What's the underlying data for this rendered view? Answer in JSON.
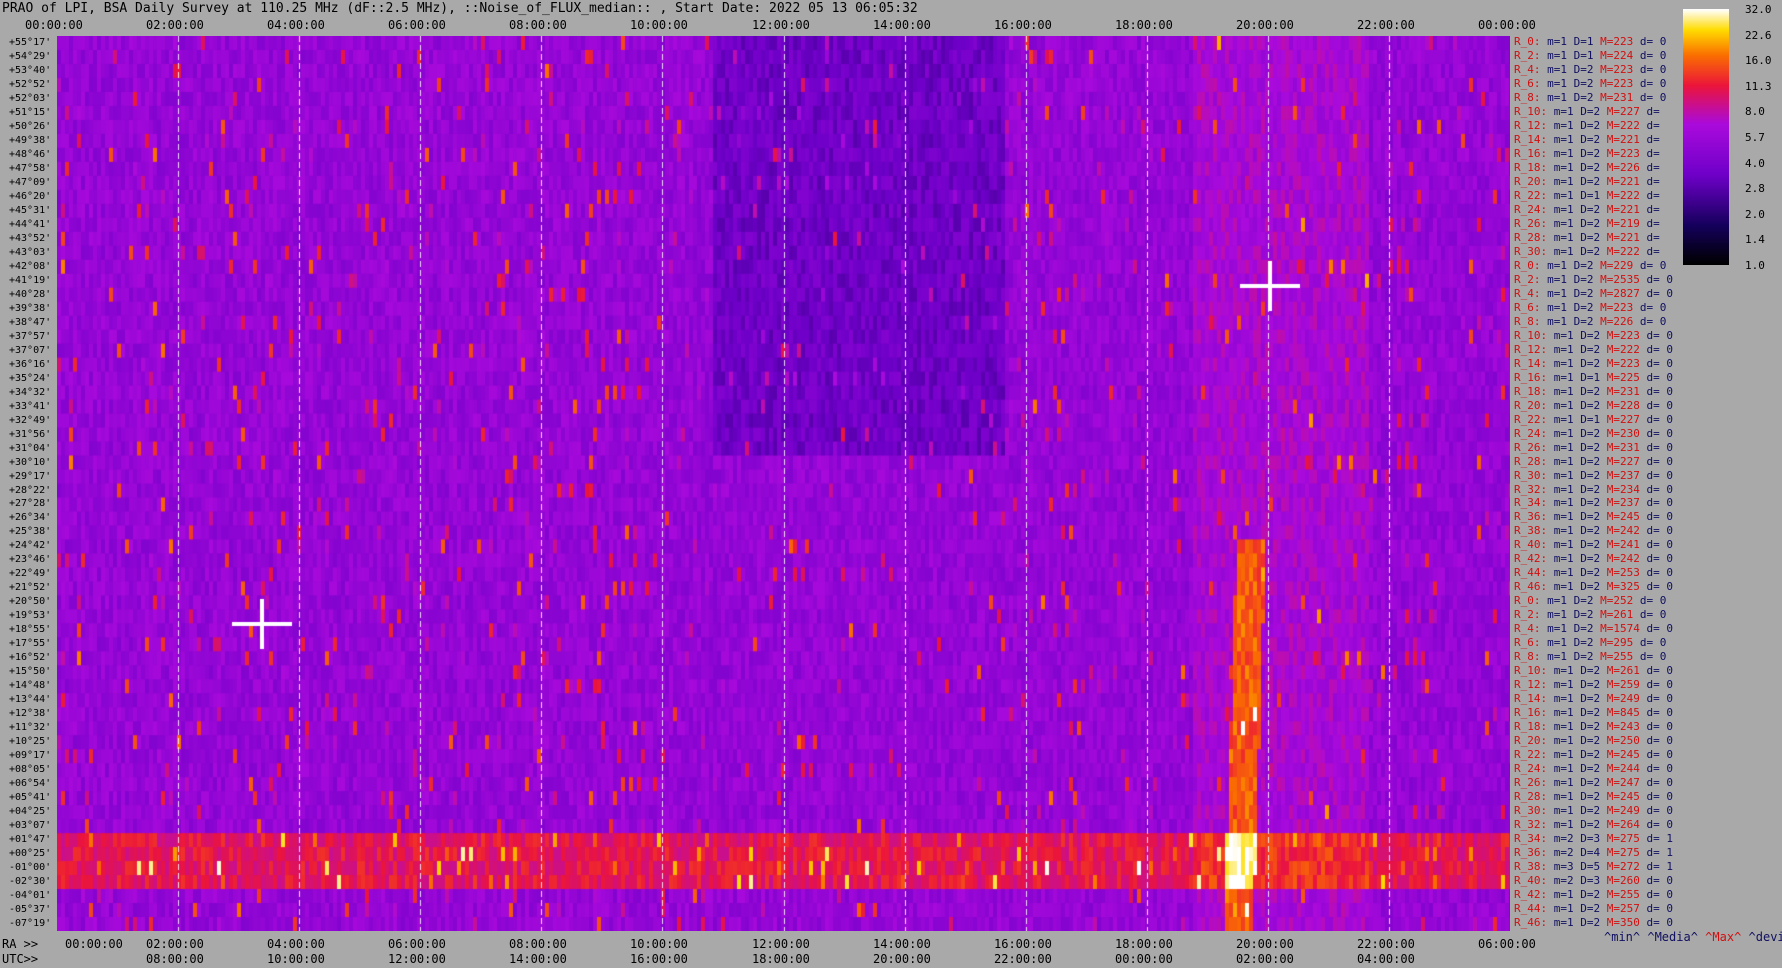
{
  "title": "PRAO of LPI, BSA Daily Survey at 110.25 MHz (dF::2.5 MHz), ::Noise_of_FLUX_median:: , Start Date: 2022 05 13 06:05:32",
  "chart_data": {
    "type": "heatmap",
    "top_ticks": [
      "00:00:00",
      "02:00:00",
      "04:00:00",
      "06:00:00",
      "08:00:00",
      "10:00:00",
      "12:00:00",
      "14:00:00",
      "16:00:00",
      "18:00:00",
      "20:00:00",
      "22:00:00",
      "00:00:00"
    ],
    "ra_prefix": "RA >>",
    "ra_ticks": [
      "00:00:00",
      "02:00:00",
      "04:00:00",
      "06:00:00",
      "08:00:00",
      "10:00:00",
      "12:00:00",
      "14:00:00",
      "16:00:00",
      "18:00:00",
      "20:00:00",
      "22:00:00",
      "06:00:00"
    ],
    "utc_prefix": "UTC>>",
    "utc_ticks": [
      "08:00:00",
      "10:00:00",
      "12:00:00",
      "14:00:00",
      "16:00:00",
      "18:00:00",
      "20:00:00",
      "22:00:00",
      "00:00:00",
      "02:00:00",
      "04:00:00"
    ],
    "declinations": [
      "+55°17'",
      "+54°29'",
      "+53°40'",
      "+52°52'",
      "+52°03'",
      "+51°15'",
      "+50°26'",
      "+49°38'",
      "+48°46'",
      "+47°58'",
      "+47°09'",
      "+46°20'",
      "+45°31'",
      "+44°41'",
      "+43°52'",
      "+43°03'",
      "+42°08'",
      "+41°19'",
      "+40°28'",
      "+39°38'",
      "+38°47'",
      "+37°57'",
      "+37°07'",
      "+36°16'",
      "+35°24'",
      "+34°32'",
      "+33°41'",
      "+32°49'",
      "+31°56'",
      "+31°04'",
      "+30°10'",
      "+29°17'",
      "+28°22'",
      "+27°28'",
      "+26°34'",
      "+25°38'",
      "+24°42'",
      "+23°46'",
      "+22°49'",
      "+21°52'",
      "+20°50'",
      "+19°53'",
      "+18°55'",
      "+17°55'",
      "+16°52'",
      "+15°50'",
      "+14°48'",
      "+13°44'",
      "+12°38'",
      "+11°32'",
      "+10°25'",
      "+09°17'",
      "+08°05'",
      "+06°54'",
      "+05°41'",
      "+04°25'",
      "+03°07'",
      "+01°47'",
      "+00°25'",
      "-01°00'",
      "-02°30'",
      "-04°01'",
      "-05°37'",
      "-07°19'"
    ],
    "colorbar": {
      "ticks": [
        "32.0",
        "22.6",
        "16.0",
        "11.3",
        "8.0",
        "5.7",
        "4.0",
        "2.8",
        "2.0",
        "1.4",
        "1.0"
      ],
      "min": 1.0,
      "max": 32.0
    },
    "stats": [
      {
        "r": "R_0:",
        "m": "m=1",
        "D": "D=1",
        "M": "M=223",
        "d": "d= 0"
      },
      {
        "r": "R_2:",
        "m": "m=1",
        "D": "D=1",
        "M": "M=224",
        "d": "d= 0"
      },
      {
        "r": "R_4:",
        "m": "m=1",
        "D": "D=2",
        "M": "M=223",
        "d": "d= 0"
      },
      {
        "r": "R_6:",
        "m": "m=1",
        "D": "D=2",
        "M": "M=223",
        "d": "d= 0"
      },
      {
        "r": "R_8:",
        "m": "m=1",
        "D": "D=2",
        "M": "M=231",
        "d": "d= 0"
      },
      {
        "r": "R_10:",
        "m": "m=1",
        "D": "D=2",
        "M": "M=227",
        "d": "d="
      },
      {
        "r": "R_12:",
        "m": "m=1",
        "D": "D=2",
        "M": "M=222",
        "d": "d="
      },
      {
        "r": "R_14:",
        "m": "m=1",
        "D": "D=2",
        "M": "M=221",
        "d": "d="
      },
      {
        "r": "R_16:",
        "m": "m=1",
        "D": "D=2",
        "M": "M=223",
        "d": "d="
      },
      {
        "r": "R_18:",
        "m": "m=1",
        "D": "D=2",
        "M": "M=226",
        "d": "d="
      },
      {
        "r": "R_20:",
        "m": "m=1",
        "D": "D=2",
        "M": "M=221",
        "d": "d="
      },
      {
        "r": "R_22:",
        "m": "m=1",
        "D": "D=1",
        "M": "M=222",
        "d": "d="
      },
      {
        "r": "R_24:",
        "m": "m=1",
        "D": "D=2",
        "M": "M=221",
        "d": "d="
      },
      {
        "r": "R_26:",
        "m": "m=1",
        "D": "D=2",
        "M": "M=219",
        "d": "d="
      },
      {
        "r": "R_28:",
        "m": "m=1",
        "D": "D=2",
        "M": "M=221",
        "d": "d="
      },
      {
        "r": "R_30:",
        "m": "m=1",
        "D": "D=2",
        "M": "M=222",
        "d": "d="
      },
      {
        "r": "R_0:",
        "m": "m=1",
        "D": "D=2",
        "M": "M=229",
        "d": "d= 0"
      },
      {
        "r": "R_2:",
        "m": "m=1",
        "D": "D=2",
        "M": "M=2535",
        "d": "d= 0"
      },
      {
        "r": "R_4:",
        "m": "m=1",
        "D": "D=2",
        "M": "M=2827",
        "d": "d= 0"
      },
      {
        "r": "R_6:",
        "m": "m=1",
        "D": "D=2",
        "M": "M=223",
        "d": "d= 0"
      },
      {
        "r": "R_8:",
        "m": "m=1",
        "D": "D=2",
        "M": "M=226",
        "d": "d= 0"
      },
      {
        "r": "R_10:",
        "m": "m=1",
        "D": "D=2",
        "M": "M=223",
        "d": "d= 0"
      },
      {
        "r": "R_12:",
        "m": "m=1",
        "D": "D=2",
        "M": "M=222",
        "d": "d= 0"
      },
      {
        "r": "R_14:",
        "m": "m=1",
        "D": "D=2",
        "M": "M=223",
        "d": "d= 0"
      },
      {
        "r": "R_16:",
        "m": "m=1",
        "D": "D=1",
        "M": "M=225",
        "d": "d= 0"
      },
      {
        "r": "R_18:",
        "m": "m=1",
        "D": "D=2",
        "M": "M=231",
        "d": "d= 0"
      },
      {
        "r": "R_20:",
        "m": "m=1",
        "D": "D=2",
        "M": "M=228",
        "d": "d= 0"
      },
      {
        "r": "R_22:",
        "m": "m=1",
        "D": "D=1",
        "M": "M=227",
        "d": "d= 0"
      },
      {
        "r": "R_24:",
        "m": "m=1",
        "D": "D=2",
        "M": "M=230",
        "d": "d= 0"
      },
      {
        "r": "R_26:",
        "m": "m=1",
        "D": "D=2",
        "M": "M=231",
        "d": "d= 0"
      },
      {
        "r": "R_28:",
        "m": "m=1",
        "D": "D=2",
        "M": "M=227",
        "d": "d= 0"
      },
      {
        "r": "R_30:",
        "m": "m=1",
        "D": "D=2",
        "M": "M=237",
        "d": "d= 0"
      },
      {
        "r": "R_32:",
        "m": "m=1",
        "D": "D=2",
        "M": "M=234",
        "d": "d= 0"
      },
      {
        "r": "R_34:",
        "m": "m=1",
        "D": "D=2",
        "M": "M=237",
        "d": "d= 0"
      },
      {
        "r": "R_36:",
        "m": "m=1",
        "D": "D=2",
        "M": "M=245",
        "d": "d= 0"
      },
      {
        "r": "R_38:",
        "m": "m=1",
        "D": "D=2",
        "M": "M=242",
        "d": "d= 0"
      },
      {
        "r": "R_40:",
        "m": "m=1",
        "D": "D=2",
        "M": "M=241",
        "d": "d= 0"
      },
      {
        "r": "R_42:",
        "m": "m=1",
        "D": "D=2",
        "M": "M=242",
        "d": "d= 0"
      },
      {
        "r": "R_44:",
        "m": "m=1",
        "D": "D=2",
        "M": "M=253",
        "d": "d= 0"
      },
      {
        "r": "R_46:",
        "m": "m=1",
        "D": "D=2",
        "M": "M=325",
        "d": "d= 0"
      },
      {
        "r": "R_0:",
        "m": "m=1",
        "D": "D=2",
        "M": "M=252",
        "d": "d= 0"
      },
      {
        "r": "R_2:",
        "m": "m=1",
        "D": "D=2",
        "M": "M=261",
        "d": "d= 0"
      },
      {
        "r": "R_4:",
        "m": "m=1",
        "D": "D=2",
        "M": "M=1574",
        "d": "d= 0"
      },
      {
        "r": "R_6:",
        "m": "m=1",
        "D": "D=2",
        "M": "M=295",
        "d": "d= 0"
      },
      {
        "r": "R_8:",
        "m": "m=1",
        "D": "D=2",
        "M": "M=255",
        "d": "d= 0"
      },
      {
        "r": "R_10:",
        "m": "m=1",
        "D": "D=2",
        "M": "M=261",
        "d": "d= 0"
      },
      {
        "r": "R_12:",
        "m": "m=1",
        "D": "D=2",
        "M": "M=259",
        "d": "d= 0"
      },
      {
        "r": "R_14:",
        "m": "m=1",
        "D": "D=2",
        "M": "M=249",
        "d": "d= 0"
      },
      {
        "r": "R_16:",
        "m": "m=1",
        "D": "D=2",
        "M": "M=845",
        "d": "d= 0"
      },
      {
        "r": "R_18:",
        "m": "m=1",
        "D": "D=2",
        "M": "M=243",
        "d": "d= 0"
      },
      {
        "r": "R_20:",
        "m": "m=1",
        "D": "D=2",
        "M": "M=250",
        "d": "d= 0"
      },
      {
        "r": "R_22:",
        "m": "m=1",
        "D": "D=2",
        "M": "M=245",
        "d": "d= 0"
      },
      {
        "r": "R_24:",
        "m": "m=1",
        "D": "D=2",
        "M": "M=244",
        "d": "d= 0"
      },
      {
        "r": "R_26:",
        "m": "m=1",
        "D": "D=2",
        "M": "M=247",
        "d": "d= 0"
      },
      {
        "r": "R_28:",
        "m": "m=1",
        "D": "D=2",
        "M": "M=245",
        "d": "d= 0"
      },
      {
        "r": "R_30:",
        "m": "m=1",
        "D": "D=2",
        "M": "M=249",
        "d": "d= 0"
      },
      {
        "r": "R_32:",
        "m": "m=1",
        "D": "D=2",
        "M": "M=264",
        "d": "d= 0"
      },
      {
        "r": "R_34:",
        "m": "m=2",
        "D": "D=3",
        "M": "M=275",
        "d": "d= 1"
      },
      {
        "r": "R_36:",
        "m": "m=2",
        "D": "D=4",
        "M": "M=275",
        "d": "d= 1"
      },
      {
        "r": "R_38:",
        "m": "m=3",
        "D": "D=5",
        "M": "M=272",
        "d": "d= 1"
      },
      {
        "r": "R_40:",
        "m": "m=2",
        "D": "D=3",
        "M": "M=260",
        "d": "d= 0"
      },
      {
        "r": "R_42:",
        "m": "m=1",
        "D": "D=2",
        "M": "M=255",
        "d": "d= 0"
      },
      {
        "r": "R_44:",
        "m": "m=1",
        "D": "D=2",
        "M": "M=257",
        "d": "d= 0"
      },
      {
        "r": "R_46:",
        "m": "m=1",
        "D": "D=2",
        "M": "M=350",
        "d": "d= 0"
      }
    ],
    "legend": {
      "min": "^min^",
      "median": "^Media^",
      "max": "^Max^",
      "dev": "^devia^"
    }
  }
}
